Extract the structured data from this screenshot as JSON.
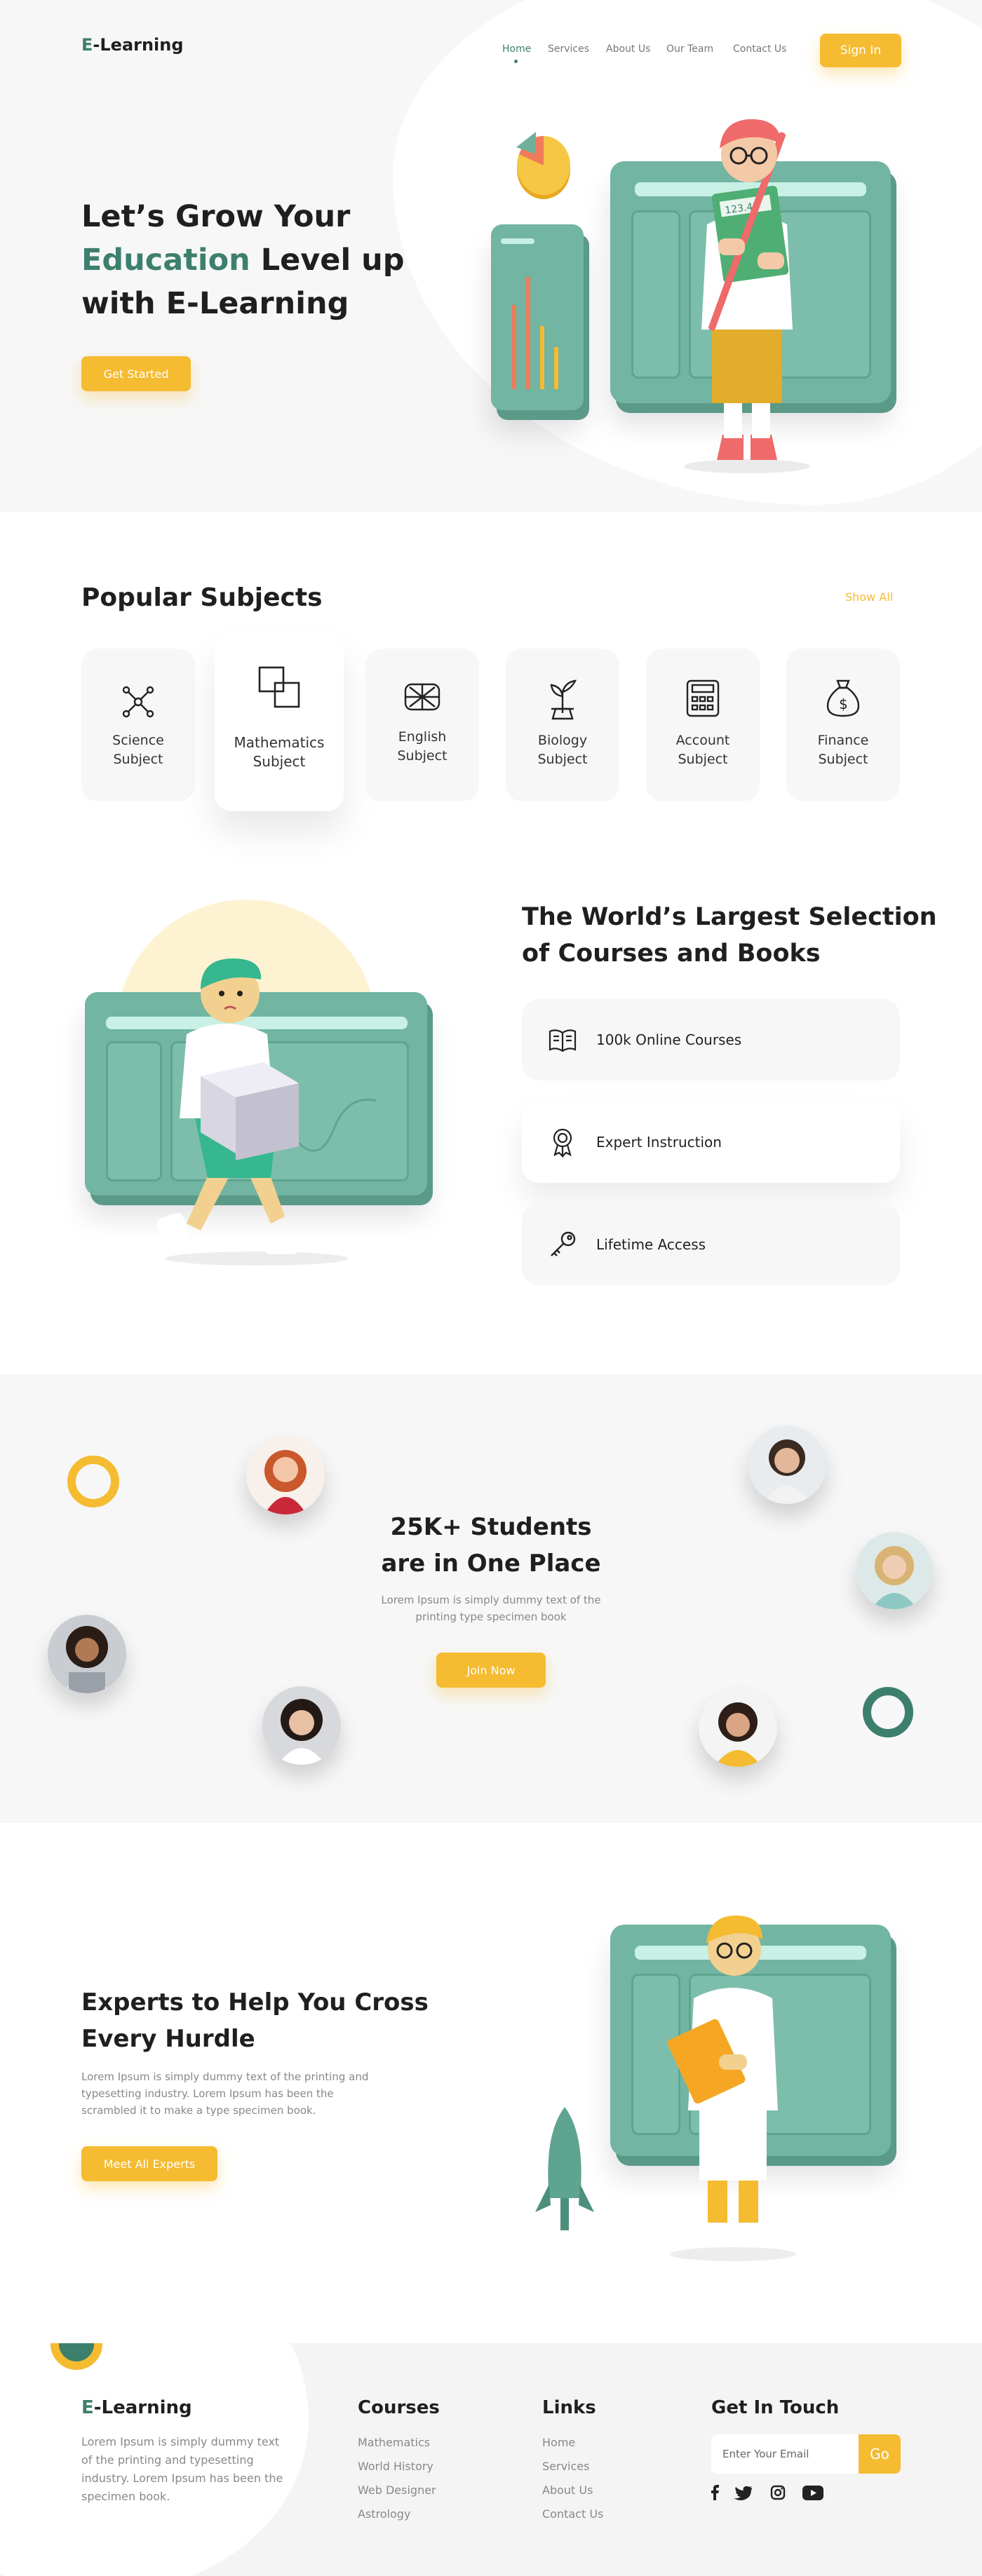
{
  "brand": {
    "logo_prefix": "E",
    "logo_rest": "-Learning",
    "accent": "#f5bb31",
    "green": "#3d7f6d"
  },
  "nav": {
    "items": [
      "Home",
      "Services",
      "About Us",
      "Our Team",
      "Contact Us"
    ],
    "active": "Home",
    "signin": "Sign In"
  },
  "hero": {
    "title_1": "Let’s Grow Your",
    "title_hl": "Education",
    "title_2": " Level up",
    "title_3": "with E-Learning",
    "cta": "Get Started",
    "board_text": "123.45"
  },
  "subjects": {
    "title": "Popular Subjects",
    "show_all": "Show All",
    "items": [
      {
        "line1": "Science",
        "line2": "Subject",
        "icon": "molecule-icon"
      },
      {
        "line1": "Mathematics",
        "line2": "Subject",
        "icon": "overlap-squares-icon"
      },
      {
        "line1": "English",
        "line2": "Subject",
        "icon": "uk-flag-icon"
      },
      {
        "line1": "Biology",
        "line2": "Subject",
        "icon": "plant-icon"
      },
      {
        "line1": "Account",
        "line2": "Subject",
        "icon": "calculator-icon"
      },
      {
        "line1": "Finance",
        "line2": "Subject",
        "icon": "money-bag-icon"
      }
    ]
  },
  "courses": {
    "title_1": "The World’s Largest Selection",
    "title_2": "of Courses and Books",
    "features": [
      {
        "label": "100k Online Courses",
        "icon": "open-book-icon"
      },
      {
        "label": "Expert Instruction",
        "icon": "award-medal-icon"
      },
      {
        "label": "Lifetime Access",
        "icon": "key-icon"
      }
    ]
  },
  "students": {
    "title_1": "25K+ Students",
    "title_2": "are in One Place",
    "text_1": "Lorem Ipsum is simply dummy text of the",
    "text_2": "printing type specimen book",
    "cta": "Join Now"
  },
  "experts": {
    "title_1": "Experts to Help You Cross",
    "title_2": "Every Hurdle",
    "text_1": "Lorem Ipsum is simply dummy text of the printing and",
    "text_2": "typesetting industry. Lorem Ipsum has been the",
    "text_3": "scrambled it to make a type specimen book.",
    "cta": "Meet All Experts"
  },
  "footer": {
    "about_1": "Lorem Ipsum is simply dummy text",
    "about_2": "of the printing and typesetting",
    "about_3": "industry. Lorem Ipsum has been the",
    "about_4": "specimen book.",
    "courses_title": "Courses",
    "courses": [
      "Mathematics",
      "World History",
      "Web Designer",
      "Astrology"
    ],
    "links_title": "Links",
    "links": [
      "Home",
      "Services",
      "About Us",
      "Contact Us"
    ],
    "contact_title": "Get In Touch",
    "email_placeholder": "Enter Your Email",
    "go": "Go",
    "social": [
      "facebook-icon",
      "twitter-icon",
      "instagram-icon",
      "youtube-icon"
    ]
  }
}
